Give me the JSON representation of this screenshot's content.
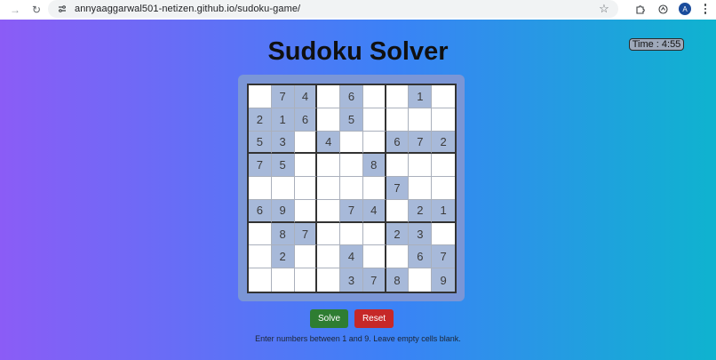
{
  "browser": {
    "url": "annyaaggarwal501-netizen.github.io/sudoku-game/",
    "avatar_initial": "A"
  },
  "page": {
    "title": "Sudoku Solver",
    "timer": "Time : 4:55",
    "solve_label": "Solve",
    "reset_label": "Reset",
    "hint": "Enter numbers between 1 and 9. Leave empty cells blank."
  },
  "colors": {
    "filled_cell": "#a7b9d9",
    "solve_button": "#2e7d32",
    "reset_button": "#c62828"
  },
  "board": [
    [
      "",
      "7",
      "4",
      "",
      "6",
      "",
      "",
      "1",
      ""
    ],
    [
      "2",
      "1",
      "6",
      "",
      "5",
      "",
      "",
      "",
      ""
    ],
    [
      "5",
      "3",
      "",
      "4",
      "",
      "",
      "6",
      "7",
      "2"
    ],
    [
      "7",
      "5",
      "",
      "",
      "",
      "8",
      "",
      "",
      ""
    ],
    [
      "",
      "",
      "",
      "",
      "",
      "",
      "7",
      "",
      ""
    ],
    [
      "6",
      "9",
      "",
      "",
      "7",
      "4",
      "",
      "2",
      "1"
    ],
    [
      "",
      "8",
      "7",
      "",
      "",
      "",
      "2",
      "3",
      ""
    ],
    [
      "",
      "2",
      "",
      "",
      "4",
      "",
      "",
      "6",
      "7"
    ],
    [
      "",
      "",
      "",
      "",
      "3",
      "7",
      "8",
      "",
      "9"
    ]
  ]
}
